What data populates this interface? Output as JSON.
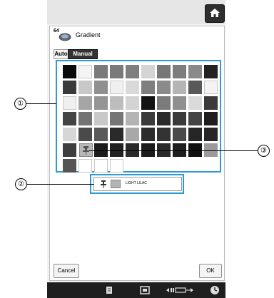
{
  "header": {
    "home_icon": "home-icon"
  },
  "title": {
    "pattern_number": "64",
    "label": "Gradient"
  },
  "tabs": [
    {
      "label": "Auto",
      "selected": false
    },
    {
      "label": "Manual",
      "selected": true
    }
  ],
  "palette": {
    "rows": [
      [
        "#0a0a0a",
        "#f4f4f4",
        "#7a7a7a",
        "#7a7a7a",
        "#7f7f7f",
        "#d4d4d4",
        "#777777",
        "#7c7c7c",
        "#8a8a8a",
        "#222222"
      ],
      [
        "#3a3a3a",
        "#c8c8c8",
        "#909090",
        "#f0f0f0",
        "#d9d9d9",
        "#7f7f7f",
        "#8b8b8b",
        "#b5b5b5",
        "#595959",
        "#f3f3f3"
      ],
      [
        "#f0f0f0",
        "#a5a5a5",
        "#959595",
        "#bdbdbd",
        "#d3d3d3",
        "#141414",
        "#7b7b7b",
        "#8f8f8f",
        "#dadada",
        "#3a3a3a"
      ],
      [
        "#444444",
        "#737373",
        "#c9c9c9",
        "#767676",
        "#b4b4b4",
        "#3b3b3b",
        "#2b2b2b",
        "#3a3a3a",
        "#444444",
        "#1e1e1e"
      ],
      [
        "#d6d6d6",
        "#4a4a4a",
        "#5a5a5a",
        "#2a2a2a",
        "#a8a8a8",
        "#2c2c2c",
        "#333333",
        "#4a4a4a",
        "#262626",
        "#262626"
      ],
      [
        "#3e3e3e",
        "#b8b8b8",
        "#1c1c1c",
        "#222222",
        "#2a2a2a",
        "#1c1c1c",
        "#2a2a2a",
        "#1e1e1e",
        "#111111",
        "#9a9a9a"
      ],
      [
        "#555555",
        "#ffffff",
        "#ffffff",
        "#ffffff"
      ]
    ]
  },
  "selected_thread": {
    "name": "LIGHT LILAC",
    "color": "#b4b4b4",
    "icon": "pin-icon"
  },
  "buttons": {
    "cancel": "Cancel",
    "ok": "OK"
  },
  "bottom_bar": {
    "icons": [
      "page-icon",
      "frame-icon",
      "embroidery-size-icon",
      "clock-icon"
    ]
  },
  "callouts": {
    "one": "①",
    "two": "②",
    "three": "③"
  }
}
